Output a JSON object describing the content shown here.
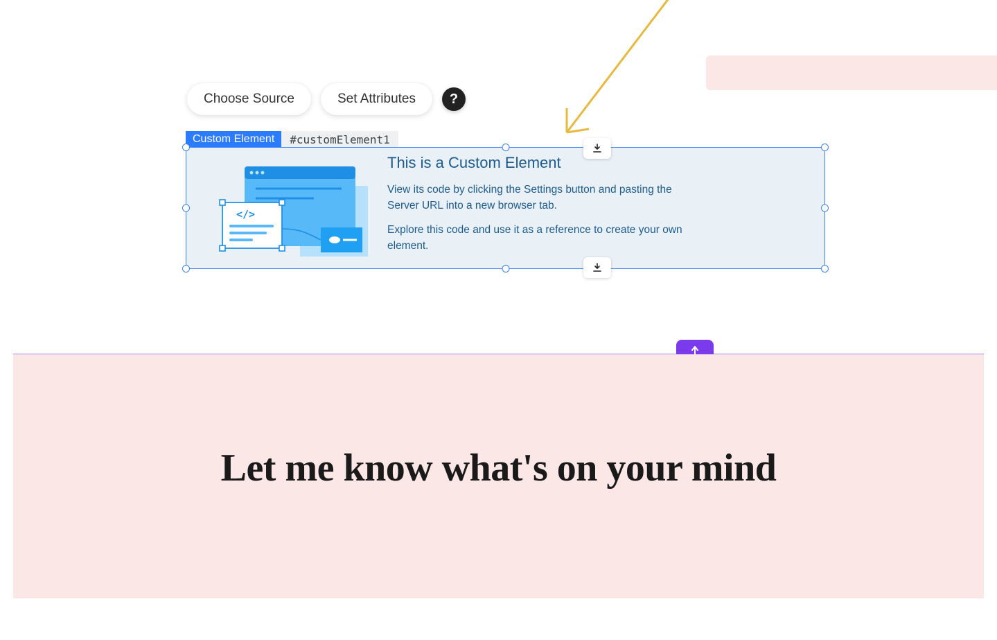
{
  "toolbar": {
    "choose_source": "Choose Source",
    "set_attributes": "Set Attributes",
    "help_glyph": "?"
  },
  "element_label": {
    "type": "Custom Element",
    "id": "#customElement1"
  },
  "custom_element": {
    "heading": "This is a Custom Element",
    "p1": "View its code by clicking the Settings button and pasting the Server URL into a new browser tab.",
    "p2": "Explore this code and use it as a reference to create your own element."
  },
  "section": {
    "heading": "Let me know what's on your mind"
  },
  "colors": {
    "selection": "#3b82f6",
    "accent_purple": "#7c3aed",
    "pink_bg": "#fce7e7"
  }
}
